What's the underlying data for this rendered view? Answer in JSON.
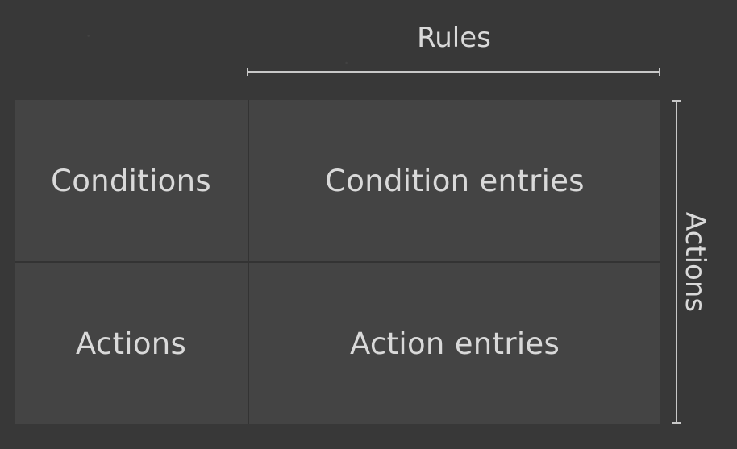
{
  "header": {
    "rules_label": "Rules"
  },
  "side": {
    "actions_label": "Actions"
  },
  "table": {
    "row1": {
      "stub": "Conditions",
      "entries": "Condition entries"
    },
    "row2": {
      "stub": "Actions",
      "entries": "Action entries"
    }
  },
  "colors": {
    "background": "#383838",
    "cell": "#444444",
    "text": "#d9d9d9",
    "bracket": "#c8c8c8"
  }
}
